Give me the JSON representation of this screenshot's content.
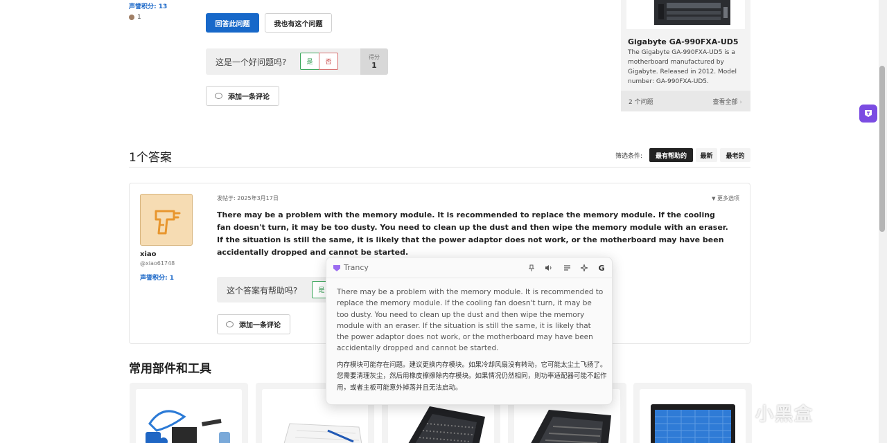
{
  "question": {
    "reputation_label": "声誉积分: 13",
    "badge_count": "1",
    "answer_button": "回答此问题",
    "same_problem_button": "我也有这个问题",
    "good_question_prompt": "这是一个好问题吗?",
    "yes_label": "是",
    "no_label": "否",
    "score_label": "得分",
    "score_value": "1",
    "add_comment": "添加一条评论"
  },
  "product": {
    "title": "Gigabyte GA-990FXA-UD5",
    "description": "The Gigabyte GA-990FXA-UD5 is a motherboard manufactured by Gigabyte. Released in 2012. Model number: GA-990FXA-UD5.",
    "question_count": "2 个问题",
    "view_all": "查看全部"
  },
  "answers": {
    "heading": "1个答案",
    "filter_label": "筛选条件:",
    "filters": [
      "最有帮助的",
      "最新",
      "最老的"
    ],
    "items": [
      {
        "user_name": "xiao",
        "user_handle": "@xiao61748",
        "reputation": "声誉积分: 1",
        "posted": "发帖于: 2025年3月17日",
        "more_options": "更多选项",
        "body": "There may be a problem with the memory module. It is recommended to replace the memory module. If the cooling fan doesn't turn, it may be too dusty. You need to clean up the dust and then wipe the memory module with an eraser. If the situation is still the same, it is likely that the power adaptor does not work, or the motherboard may have been accidentally dropped and cannot be started.",
        "helpful_prompt": "这个答案有帮助吗?",
        "yes_label": "是",
        "add_comment": "添加一条评论"
      }
    ]
  },
  "tools": {
    "heading": "常用部件和工具"
  },
  "translator": {
    "brand": "Trancy",
    "source": "There may be a problem with the memory module. It is recommended to replace the memory module. If the cooling fan doesn't turn, it may be too dusty. You need to clean up the dust and then wipe the memory module with an eraser. If the situation is still the same, it is likely that the power adaptor does not work, or the motherboard may have been accidentally dropped and cannot be started.",
    "translation": "内存模块可能存在问题。建议更换内存模块。如果冷却风扇没有转动，它可能太尘土飞扬了。您需要清理灰尘，然后用橡皮擦擦除内存模块。如果情况仍然相同，则功率适配器可能不起作用，或者主板可能意外掉落并且无法启动。",
    "tools": [
      "pin-icon",
      "speaker-icon",
      "list-icon",
      "sparkle-icon",
      "google-icon"
    ]
  },
  "watermark": "小黑盒",
  "colors": {
    "primary": "#1768c9",
    "accent": "#7b4ce2",
    "yes": "#2f9b4f",
    "no": "#c94545"
  }
}
